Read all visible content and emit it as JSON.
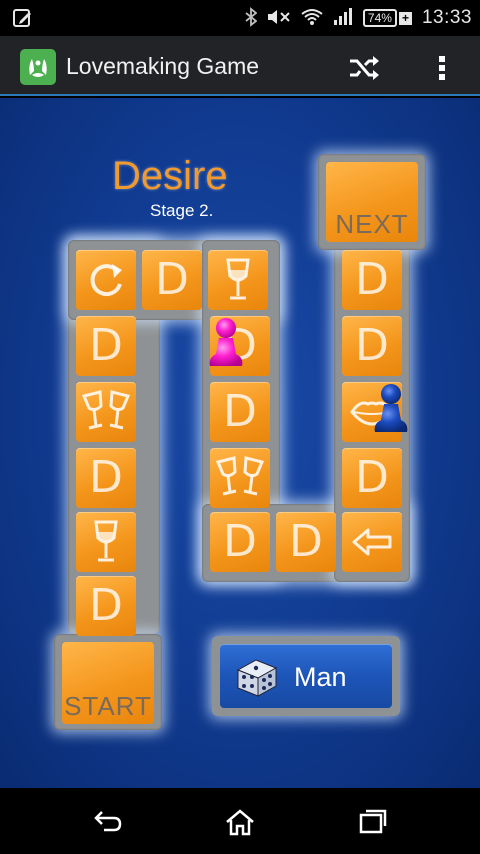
{
  "status_bar": {
    "battery": "74%",
    "time": "13:33"
  },
  "action_bar": {
    "title": "Lovemaking Game"
  },
  "board": {
    "title": "Desire",
    "subtitle": "Stage 2.",
    "start_label": "START",
    "next_label": "NEXT",
    "tile_letter": "D",
    "tiles": [
      {
        "type": "start",
        "label": "START"
      },
      {
        "type": "D"
      },
      {
        "type": "glass"
      },
      {
        "type": "D"
      },
      {
        "type": "glasses"
      },
      {
        "type": "D"
      },
      {
        "type": "D"
      },
      {
        "type": "reload"
      },
      {
        "type": "D"
      },
      {
        "type": "glass"
      },
      {
        "type": "D"
      },
      {
        "type": "D"
      },
      {
        "type": "glasses"
      },
      {
        "type": "D"
      },
      {
        "type": "D"
      },
      {
        "type": "D"
      },
      {
        "type": "arrow-left"
      },
      {
        "type": "D"
      },
      {
        "type": "lips"
      },
      {
        "type": "D"
      },
      {
        "type": "D"
      },
      {
        "type": "next",
        "label": "NEXT"
      }
    ],
    "players": [
      {
        "name": "pink-pawn",
        "color": "#ff1fd0",
        "tile_index": 11
      },
      {
        "name": "blue-pawn",
        "color": "#1b4bbf",
        "tile_index": 18
      }
    ]
  },
  "dice_button": {
    "label": "Man",
    "icon": "dice-icon"
  },
  "nav": {
    "back_icon": "back-icon",
    "home_icon": "home-icon",
    "recents_icon": "recents-icon"
  },
  "colors": {
    "background": "#103a8f",
    "tile": "#f4961c",
    "frame": "#8f9294",
    "title": "#f29a2e",
    "button": "#1d55b8"
  }
}
